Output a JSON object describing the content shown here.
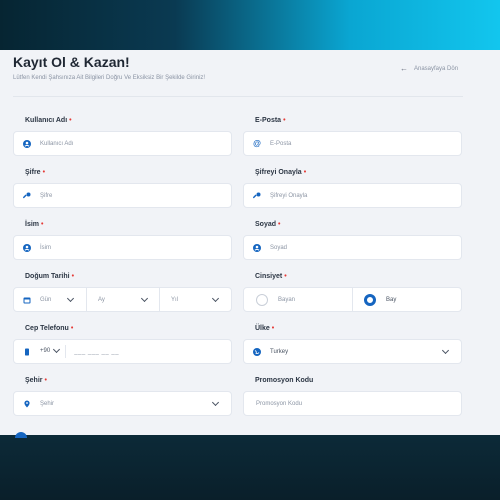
{
  "header": {
    "title": "Kayıt Ol & Kazan!",
    "subtitle": "Lütfen Kendi Şahsınıza Ait Bilgileri Doğru Ve Eksiksiz Bir Şekilde Giriniz!",
    "back_label": "Anasayfaya Dön"
  },
  "form": {
    "username": {
      "label": "Kullanıcı Adı",
      "placeholder": "Kullanıcı Adı",
      "required": "•"
    },
    "email": {
      "label": "E-Posta",
      "placeholder": "E-Posta",
      "required": "•"
    },
    "password": {
      "label": "Şifre",
      "placeholder": "Şifre",
      "required": "•"
    },
    "password_confirm": {
      "label": "Şifreyi Onayla",
      "placeholder": "Şifreyi Onayla",
      "required": "•"
    },
    "first_name": {
      "label": "İsim",
      "placeholder": "İsim",
      "required": "•"
    },
    "last_name": {
      "label": "Soyad",
      "placeholder": "Soyad",
      "required": "•"
    },
    "birth_date": {
      "label": "Doğum Tarihi",
      "required": "•",
      "day": "Gün",
      "month": "Ay",
      "year": "Yıl"
    },
    "gender": {
      "label": "Cinsiyet",
      "required": "•",
      "female": "Bayan",
      "male": "Bay",
      "selected": "Bay"
    },
    "phone": {
      "label": "Cep Telefonu",
      "required": "•",
      "country_code": "+90",
      "placeholder": "___ ___ __ __"
    },
    "country": {
      "label": "Ülke",
      "required": "•",
      "value": "Turkey"
    },
    "city": {
      "label": "Şehir",
      "required": "•",
      "placeholder": "Şehir"
    },
    "promo": {
      "label": "Promosyon Kodu",
      "placeholder": "Promosyon Kodu"
    }
  },
  "colors": {
    "accent": "#1565c0",
    "required": "#e53935",
    "panel_bg": "#f1f3f7"
  },
  "icons": {
    "back": "arrow-left-icon",
    "user": "user-icon",
    "at": "at-icon",
    "key": "key-icon",
    "calendar": "calendar-icon",
    "phone": "phone-icon",
    "globe": "globe-icon",
    "location": "map-pin-icon"
  }
}
